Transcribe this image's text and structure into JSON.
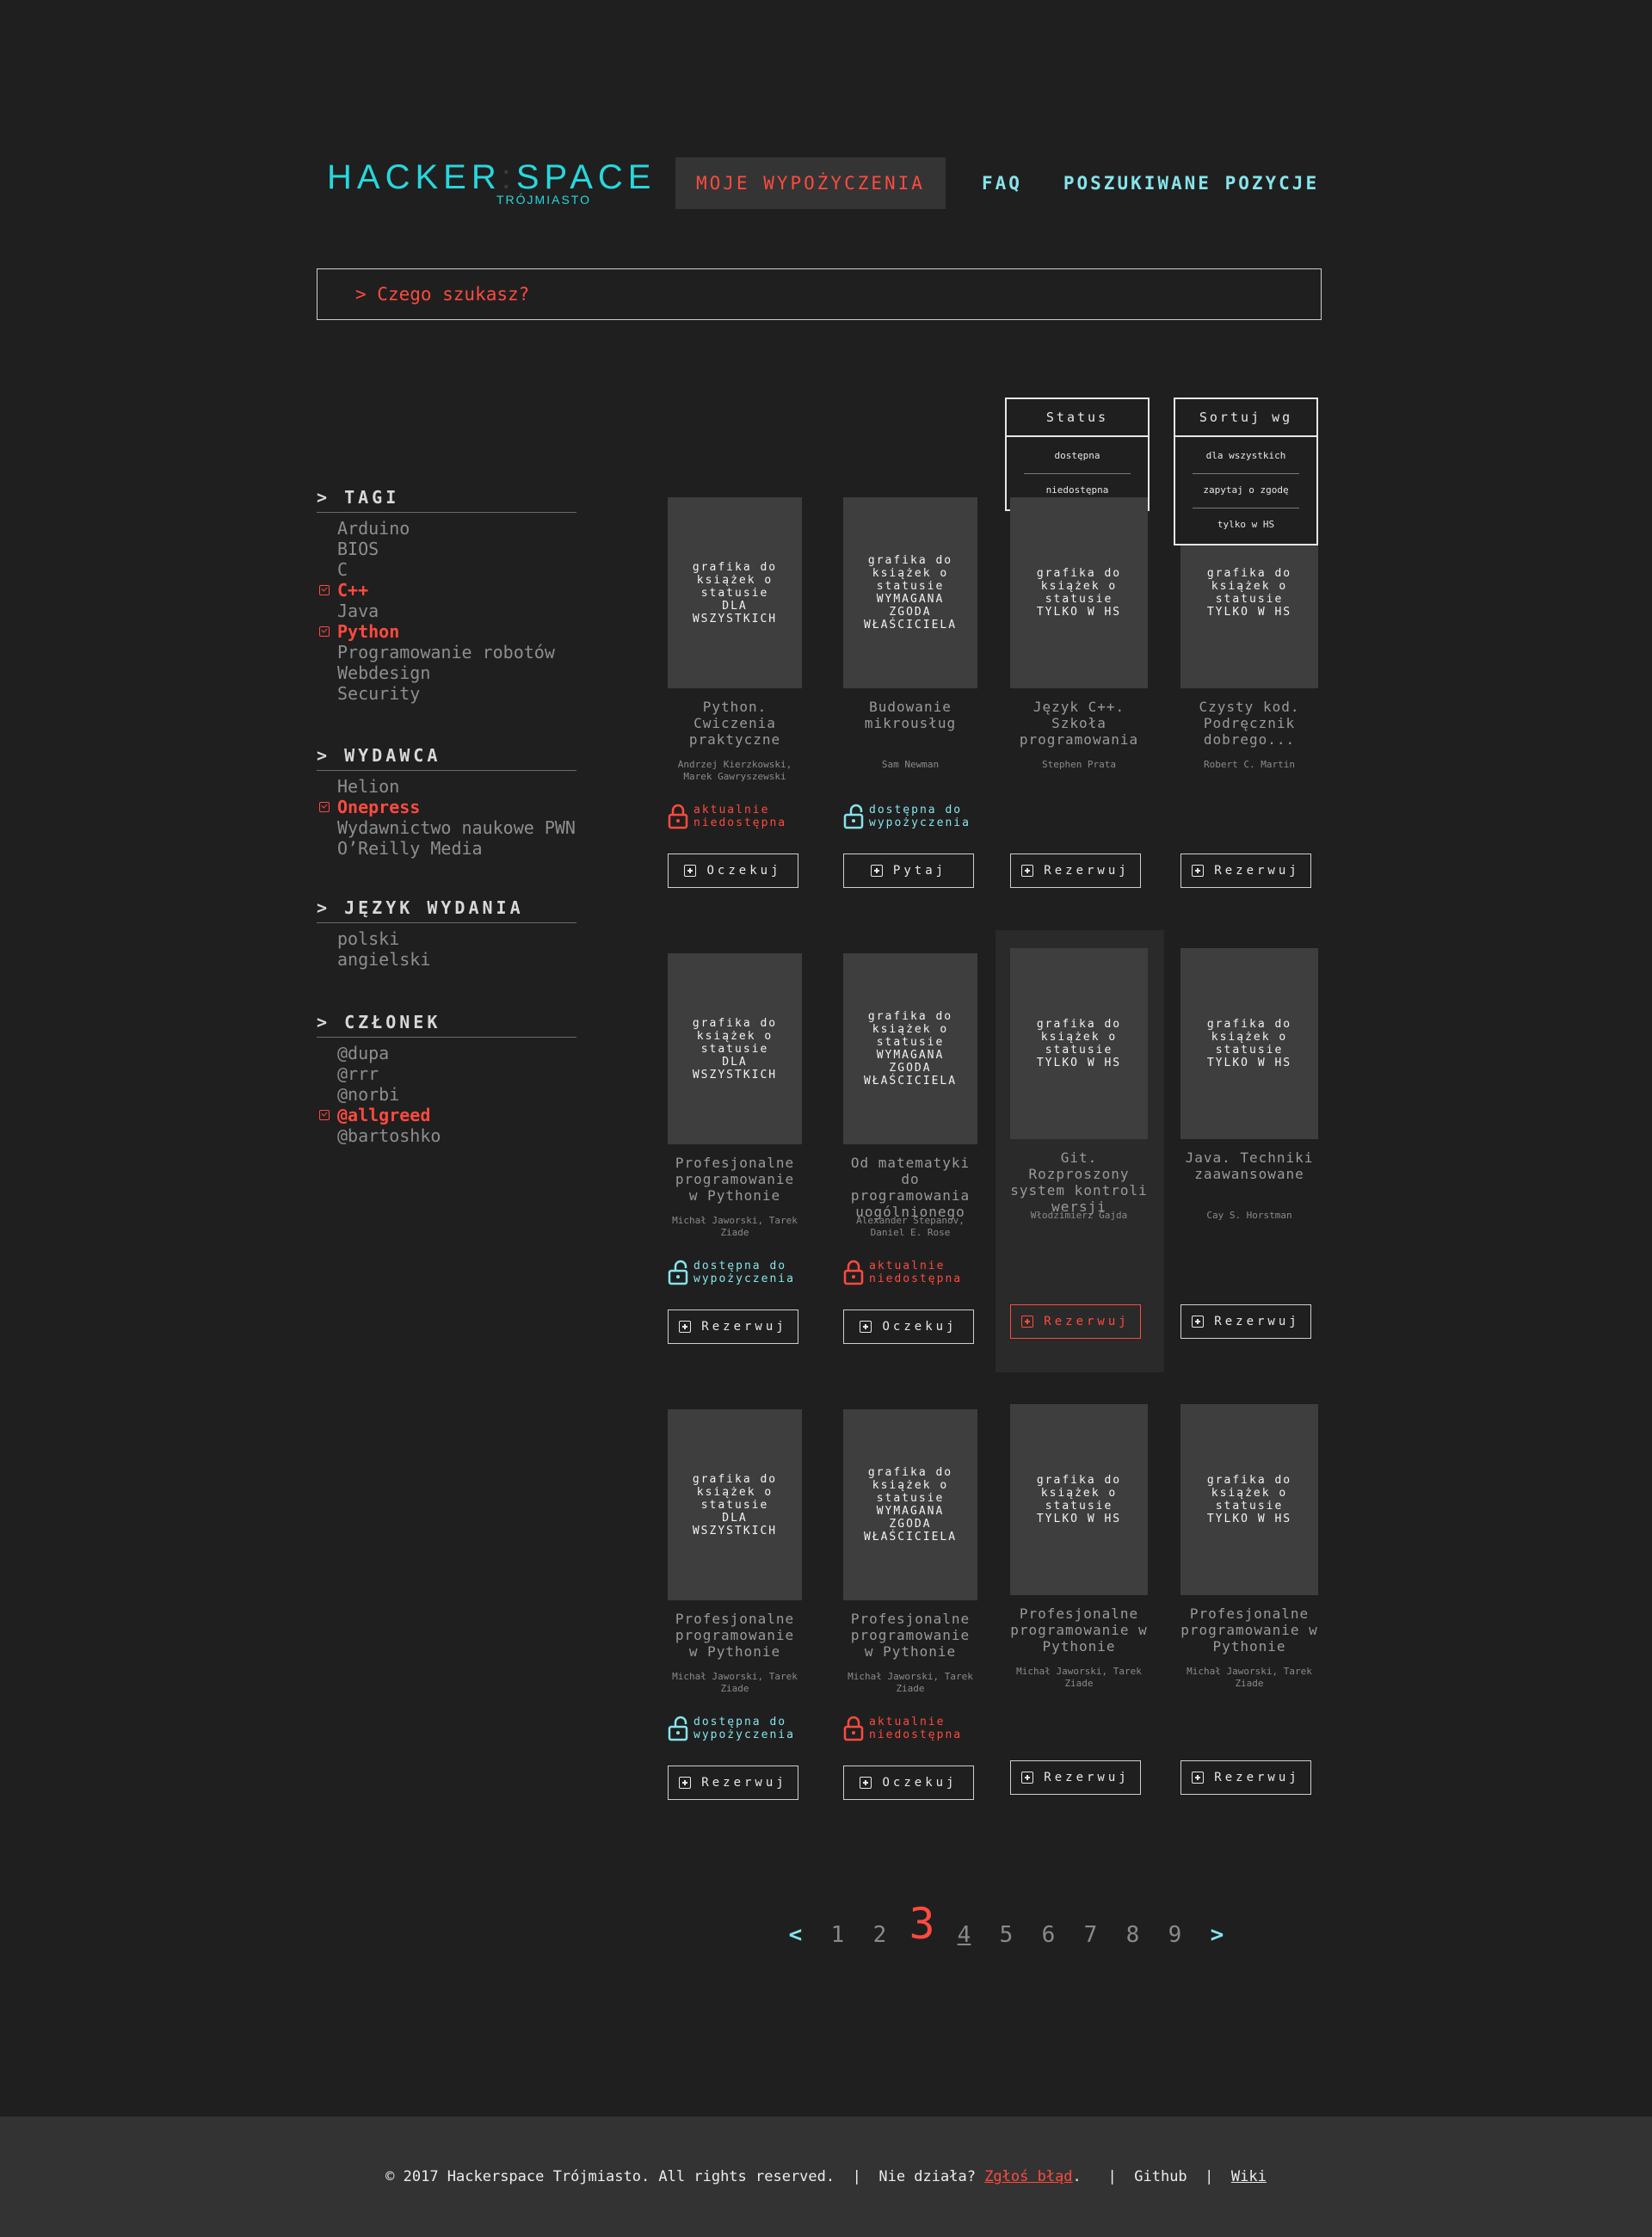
{
  "header": {
    "logo_main": "HACKER",
    "logo_colon": ":",
    "logo_main2": "SPACE",
    "logo_sub": "TRÓJMIASTO",
    "nav": [
      "MOJE WYPOŻYCZENIA",
      "FAQ",
      "POSZUKIWANE POZYCJE"
    ]
  },
  "search": {
    "placeholder": "> Czego szukasz?"
  },
  "sidebar": {
    "sections": [
      {
        "title": "> TAGI",
        "items": [
          {
            "label": "Arduino",
            "selected": false
          },
          {
            "label": "BIOS",
            "selected": false
          },
          {
            "label": "C",
            "selected": false
          },
          {
            "label": "C++",
            "selected": true
          },
          {
            "label": "Java",
            "selected": false
          },
          {
            "label": "Python",
            "selected": true
          },
          {
            "label": "Programowanie robotów",
            "selected": false
          },
          {
            "label": "Webdesign",
            "selected": false
          },
          {
            "label": "Security",
            "selected": false
          }
        ]
      },
      {
        "title": "> WYDAWCA",
        "items": [
          {
            "label": "Helion",
            "selected": false
          },
          {
            "label": "Onepress",
            "selected": true
          },
          {
            "label": "Wydawnictwo naukowe PWN",
            "selected": false
          },
          {
            "label": "O’Reilly Media",
            "selected": false
          }
        ]
      },
      {
        "title": "> JĘZYK WYDANIA",
        "items": [
          {
            "label": "polski",
            "selected": false
          },
          {
            "label": "angielski",
            "selected": false
          }
        ]
      },
      {
        "title": "> CZŁONEK",
        "items": [
          {
            "label": "@dupa",
            "selected": false
          },
          {
            "label": "@rrr",
            "selected": false
          },
          {
            "label": "@norbi",
            "selected": false
          },
          {
            "label": "@allgreed",
            "selected": true
          },
          {
            "label": "@bartoshko",
            "selected": false
          }
        ]
      }
    ]
  },
  "filters": {
    "status": {
      "label": "Status",
      "options": [
        "dostępna",
        "niedostępna"
      ]
    },
    "sort": {
      "label": "Sortuj wg",
      "options": [
        "dla wszystkich",
        "zapytaj o zgodę",
        "tylko w HS"
      ]
    }
  },
  "books": [
    {
      "cover": [
        "grafika do",
        "książek o",
        "statusie",
        "DLA",
        "WSZYSTKICH"
      ],
      "title": "Python. Cwiczenia praktyczne",
      "author": "Andrzej Kierzkowski, Marek Gawryszewski",
      "status": "aktualnie niedostępna",
      "status_kind": "red",
      "button": "Oczekuj",
      "btn_kind": "normal"
    },
    {
      "cover": [
        "grafika do",
        "książek o",
        "statusie",
        "WYMAGANA",
        "ZGODA",
        "WŁAŚCICIELA"
      ],
      "title": "Budowanie mikrousług",
      "author": "Sam Newman",
      "status": "dostępna do wypożyczenia",
      "status_kind": "cyan",
      "button": "Pytaj",
      "btn_kind": "normal"
    },
    {
      "cover": [
        "grafika do",
        "książek o",
        "statusie",
        "TYLKO W HS"
      ],
      "title": "Język C++. Szkoła programowania",
      "author": "Stephen Prata",
      "status": "",
      "status_kind": "none",
      "button": "Rezerwuj",
      "btn_kind": "normal"
    },
    {
      "cover": [
        "grafika do",
        "książek o",
        "statusie",
        "TYLKO W HS"
      ],
      "title": "Czysty kod. Podręcznik dobrego...",
      "author": "Robert C. Martin",
      "status": "",
      "status_kind": "none",
      "button": "Rezerwuj",
      "btn_kind": "normal"
    },
    {
      "cover": [
        "grafika do",
        "książek o",
        "statusie",
        "DLA",
        "WSZYSTKICH"
      ],
      "title": "Profesjonalne programowanie w Pythonie",
      "author": "Michał Jaworski, Tarek Ziade",
      "status": "dostępna do wypożyczenia",
      "status_kind": "cyan",
      "button": "Rezerwuj",
      "btn_kind": "normal"
    },
    {
      "cover": [
        "grafika do",
        "książek o",
        "statusie",
        "WYMAGANA",
        "ZGODA",
        "WŁAŚCICIELA"
      ],
      "title": "Od matematyki do programowania uogólnionego",
      "author": "Alexander Stepanov, Daniel E. Rose",
      "status": "aktualnie niedostępna",
      "status_kind": "red",
      "button": "Oczekuj",
      "btn_kind": "normal"
    },
    {
      "cover": [
        "grafika do",
        "książek o",
        "statusie",
        "TYLKO W HS"
      ],
      "title": "Git. Rozproszony system kontroli wersji",
      "author": "Włodzimierz Gajda",
      "status": "",
      "status_kind": "none",
      "button": "Rezerwuj",
      "btn_kind": "red"
    },
    {
      "cover": [
        "grafika do",
        "książek o",
        "statusie",
        "TYLKO W HS"
      ],
      "title": "Java. Techniki zaawansowane",
      "author": "Cay S. Horstman",
      "status": "",
      "status_kind": "none",
      "button": "Rezerwuj",
      "btn_kind": "normal"
    },
    {
      "cover": [
        "grafika do",
        "książek o",
        "statusie",
        "DLA",
        "WSZYSTKICH"
      ],
      "title": "Profesjonalne programowanie w Pythonie",
      "author": "Michał Jaworski, Tarek Ziade",
      "status": "dostępna do wypożyczenia",
      "status_kind": "cyan",
      "button": "Rezerwuj",
      "btn_kind": "normal"
    },
    {
      "cover": [
        "grafika do",
        "książek o",
        "statusie",
        "WYMAGANA",
        "ZGODA",
        "WŁAŚCICIELA"
      ],
      "title": "Profesjonalne programowanie w Pythonie",
      "author": "Michał Jaworski, Tarek Ziade",
      "status": "aktualnie niedostępna",
      "status_kind": "red",
      "button": "Oczekuj",
      "btn_kind": "normal"
    },
    {
      "cover": [
        "grafika do",
        "książek o",
        "statusie",
        "TYLKO W HS"
      ],
      "title": "Profesjonalne programowanie w Pythonie",
      "author": "Michał Jaworski, Tarek Ziade",
      "status": "",
      "status_kind": "none",
      "button": "Rezerwuj",
      "btn_kind": "normal"
    },
    {
      "cover": [
        "grafika do",
        "książek o",
        "statusie",
        "TYLKO W HS"
      ],
      "title": "Profesjonalne programowanie w Pythonie",
      "author": "Michał Jaworski, Tarek Ziade",
      "status": "",
      "status_kind": "none",
      "button": "Rezerwuj",
      "btn_kind": "normal"
    }
  ],
  "pagination": {
    "prev": "<",
    "next": ">",
    "pages": [
      "1",
      "2",
      "3",
      "4",
      "5",
      "6",
      "7",
      "8",
      "9"
    ],
    "current": "3"
  },
  "footer": {
    "copyright": "© 2017 Hackerspace Trójmiasto. All rights reserved.",
    "sep": "|",
    "broken": "Nie działa?",
    "report": "Zgłoś błąd",
    "dot": ".",
    "github": "Github",
    "wiki": "Wiki"
  },
  "colors": {
    "accent_red": "#ff4a3f",
    "accent_cyan": "#26d8dc",
    "bg": "#1f1f1f"
  }
}
